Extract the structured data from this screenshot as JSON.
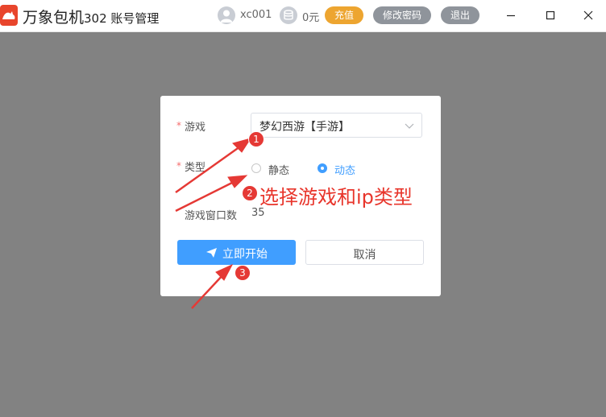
{
  "titlebar": {
    "app_name": "万象包机",
    "subtitle": "302 账号管理",
    "username": "xc001",
    "balance": "0元",
    "recharge_label": "充值",
    "change_password_label": "修改密码",
    "logout_label": "退出"
  },
  "dialog": {
    "required_mark": "*",
    "game_label": "游戏",
    "game_value": "梦幻西游【手游】",
    "type_label": "类型",
    "type_options": [
      "静态",
      "动态"
    ],
    "type_selected": "动态",
    "window_count_label": "游戏窗口数",
    "window_count_value": "35",
    "start_label": "立即开始",
    "cancel_label": "取消"
  },
  "annotation": {
    "steps": [
      "1",
      "2",
      "3"
    ],
    "text": "选择游戏和ip类型"
  },
  "colors": {
    "primary": "#409eff",
    "recharge": "#eda530",
    "gray_button": "#8f949b",
    "overlay": "#828282",
    "annotation_red": "#e53935",
    "logo": "#e8452c"
  }
}
